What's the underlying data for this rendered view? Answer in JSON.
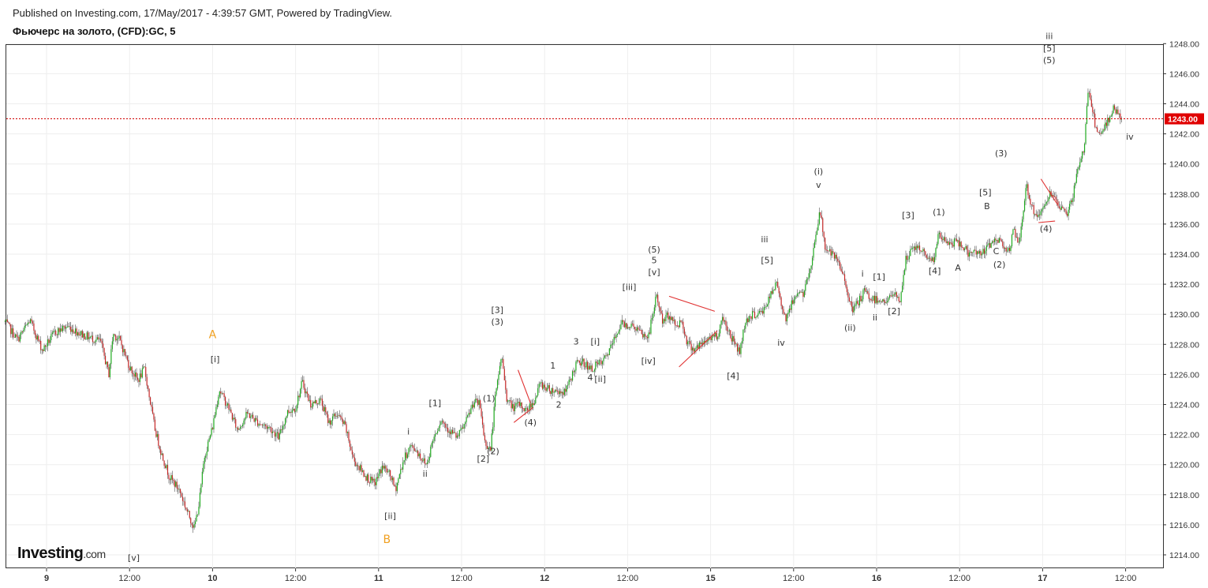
{
  "header": {
    "published": "Published on Investing.com, 17/May/2017 - 4:39:57 GMT, Powered by TradingView.",
    "instrument": "Фьючерс на золото, (CFD):GC, 5"
  },
  "logo": {
    "word": "Investing",
    "suffix": ".com"
  },
  "colors": {
    "up": "#1faa1f",
    "down": "#c62828",
    "wick": "#555555",
    "price_line": "#d00000",
    "pattern": "#e03030",
    "wave_orange": "#f0a020"
  },
  "chart_data": {
    "type": "candlestick",
    "title": "",
    "ylim": [
      1213.5,
      1249
    ],
    "y_ticks": [
      "1214.00",
      "1216.00",
      "1218.00",
      "1220.00",
      "1222.00",
      "1224.00",
      "1226.00",
      "1228.00",
      "1230.00",
      "1232.00",
      "1234.00",
      "1236.00",
      "1238.00",
      "1240.00",
      "1242.00",
      "1244.00",
      "1246.00",
      "1248.00"
    ],
    "x_ticks": [
      {
        "label": "9",
        "x": 0,
        "bold": true
      },
      {
        "label": "12:00",
        "x": 1,
        "bold": false
      },
      {
        "label": "10",
        "x": 2,
        "bold": true
      },
      {
        "label": "12:00",
        "x": 3,
        "bold": false
      },
      {
        "label": "11",
        "x": 4,
        "bold": true
      },
      {
        "label": "12:00",
        "x": 5,
        "bold": false
      },
      {
        "label": "12",
        "x": 6,
        "bold": true
      },
      {
        "label": "12:00",
        "x": 7,
        "bold": false
      },
      {
        "label": "15",
        "x": 8,
        "bold": true
      },
      {
        "label": "12:00",
        "x": 9,
        "bold": false
      },
      {
        "label": "16",
        "x": 10,
        "bold": true
      },
      {
        "label": "12:00",
        "x": 11,
        "bold": false
      },
      {
        "label": "17",
        "x": 12,
        "bold": true
      },
      {
        "label": "12:00",
        "x": 13,
        "bold": false
      }
    ],
    "xlim": [
      -0.5,
      14.0
    ],
    "last_price": "1243.00",
    "last_price_value": 1243.0,
    "price_path": [
      [
        -0.5,
        1229.5
      ],
      [
        -0.35,
        1228.3
      ],
      [
        -0.2,
        1229.6
      ],
      [
        -0.05,
        1227.6
      ],
      [
        0.1,
        1228.8
      ],
      [
        0.25,
        1229.2
      ],
      [
        0.45,
        1228.6
      ],
      [
        0.65,
        1228.2
      ],
      [
        0.75,
        1226.0
      ],
      [
        0.8,
        1228.7
      ],
      [
        0.88,
        1228.3
      ],
      [
        1.0,
        1226.5
      ],
      [
        1.1,
        1225.6
      ],
      [
        1.18,
        1226.4
      ],
      [
        1.3,
        1222.5
      ],
      [
        1.38,
        1220.8
      ],
      [
        1.48,
        1219.2
      ],
      [
        1.6,
        1218.3
      ],
      [
        1.7,
        1216.8
      ],
      [
        1.78,
        1215.8
      ],
      [
        1.84,
        1217.5
      ],
      [
        1.9,
        1220.5
      ],
      [
        2.0,
        1222.5
      ],
      [
        2.08,
        1225.0
      ],
      [
        2.2,
        1223.7
      ],
      [
        2.3,
        1222.3
      ],
      [
        2.42,
        1223.4
      ],
      [
        2.55,
        1222.8
      ],
      [
        2.7,
        1222.4
      ],
      [
        2.8,
        1221.8
      ],
      [
        2.9,
        1223.5
      ],
      [
        3.0,
        1223.8
      ],
      [
        3.08,
        1225.5
      ],
      [
        3.18,
        1224.0
      ],
      [
        3.3,
        1224.3
      ],
      [
        3.4,
        1222.8
      ],
      [
        3.5,
        1223.4
      ],
      [
        3.6,
        1222.5
      ],
      [
        3.7,
        1220.3
      ],
      [
        3.85,
        1219.2
      ],
      [
        3.95,
        1218.7
      ],
      [
        4.05,
        1219.9
      ],
      [
        4.15,
        1219.2
      ],
      [
        4.2,
        1218.3
      ],
      [
        4.3,
        1220.3
      ],
      [
        4.38,
        1221.2
      ],
      [
        4.45,
        1221.0
      ],
      [
        4.52,
        1220.4
      ],
      [
        4.58,
        1220.0
      ],
      [
        4.65,
        1221.6
      ],
      [
        4.75,
        1223.0
      ],
      [
        4.85,
        1222.3
      ],
      [
        4.95,
        1221.8
      ],
      [
        5.05,
        1222.8
      ],
      [
        5.15,
        1224.2
      ],
      [
        5.22,
        1224.0
      ],
      [
        5.28,
        1221.5
      ],
      [
        5.35,
        1221.0
      ],
      [
        5.4,
        1224.2
      ],
      [
        5.48,
        1227.3
      ],
      [
        5.55,
        1224.2
      ],
      [
        5.63,
        1223.8
      ],
      [
        5.7,
        1224.0
      ],
      [
        5.78,
        1223.6
      ],
      [
        5.88,
        1224.3
      ],
      [
        5.95,
        1225.4
      ],
      [
        6.05,
        1225.0
      ],
      [
        6.15,
        1224.9
      ],
      [
        6.25,
        1224.8
      ],
      [
        6.3,
        1225.5
      ],
      [
        6.38,
        1226.7
      ],
      [
        6.48,
        1226.8
      ],
      [
        6.55,
        1226.3
      ],
      [
        6.62,
        1226.6
      ],
      [
        6.7,
        1226.8
      ],
      [
        6.8,
        1227.8
      ],
      [
        6.92,
        1229.4
      ],
      [
        7.0,
        1229.3
      ],
      [
        7.08,
        1229.2
      ],
      [
        7.18,
        1228.6
      ],
      [
        7.25,
        1228.5
      ],
      [
        7.35,
        1231.3
      ],
      [
        7.42,
        1229.5
      ],
      [
        7.5,
        1230.0
      ],
      [
        7.58,
        1229.2
      ],
      [
        7.65,
        1229.6
      ],
      [
        7.72,
        1228.1
      ],
      [
        7.8,
        1227.7
      ],
      [
        7.9,
        1228.0
      ],
      [
        8.0,
        1228.5
      ],
      [
        8.08,
        1228.6
      ],
      [
        8.15,
        1229.8
      ],
      [
        8.22,
        1228.8
      ],
      [
        8.28,
        1228.2
      ],
      [
        8.35,
        1227.5
      ],
      [
        8.42,
        1229.6
      ],
      [
        8.52,
        1230.0
      ],
      [
        8.62,
        1230.1
      ],
      [
        8.72,
        1231.2
      ],
      [
        8.8,
        1232.1
      ],
      [
        8.85,
        1230.8
      ],
      [
        8.9,
        1229.7
      ],
      [
        8.98,
        1230.7
      ],
      [
        9.05,
        1231.6
      ],
      [
        9.12,
        1231.3
      ],
      [
        9.2,
        1233.0
      ],
      [
        9.28,
        1235.8
      ],
      [
        9.32,
        1236.8
      ],
      [
        9.38,
        1234.5
      ],
      [
        9.45,
        1234.0
      ],
      [
        9.52,
        1233.6
      ],
      [
        9.62,
        1232.3
      ],
      [
        9.7,
        1230.2
      ],
      [
        9.78,
        1230.8
      ],
      [
        9.85,
        1231.5
      ],
      [
        9.95,
        1231.0
      ],
      [
        10.05,
        1231.0
      ],
      [
        10.12,
        1230.8
      ],
      [
        10.2,
        1231.4
      ],
      [
        10.28,
        1230.9
      ],
      [
        10.35,
        1233.6
      ],
      [
        10.45,
        1234.5
      ],
      [
        10.52,
        1234.3
      ],
      [
        10.6,
        1234.0
      ],
      [
        10.68,
        1233.5
      ],
      [
        10.75,
        1235.3
      ],
      [
        10.85,
        1234.7
      ],
      [
        10.95,
        1234.8
      ],
      [
        11.05,
        1234.5
      ],
      [
        11.12,
        1233.9
      ],
      [
        11.2,
        1234.2
      ],
      [
        11.3,
        1234.1
      ],
      [
        11.38,
        1234.8
      ],
      [
        11.45,
        1235.0
      ],
      [
        11.52,
        1234.7
      ],
      [
        11.6,
        1234.2
      ],
      [
        11.65,
        1235.6
      ],
      [
        11.72,
        1234.5
      ],
      [
        11.8,
        1238.6
      ],
      [
        11.9,
        1236.6
      ],
      [
        12.0,
        1236.8
      ],
      [
        12.08,
        1238.1
      ],
      [
        12.15,
        1237.5
      ],
      [
        12.22,
        1237.0
      ],
      [
        12.3,
        1236.8
      ],
      [
        12.35,
        1237.5
      ],
      [
        12.42,
        1239.5
      ],
      [
        12.5,
        1241.0
      ],
      [
        12.55,
        1245.2
      ],
      [
        12.6,
        1243.6
      ],
      [
        12.65,
        1242.0
      ],
      [
        12.72,
        1242.0
      ],
      [
        12.78,
        1242.8
      ],
      [
        12.85,
        1243.8
      ],
      [
        12.9,
        1243.4
      ],
      [
        12.95,
        1243.0
      ]
    ],
    "annotations": [
      {
        "text": "A",
        "x": 2.0,
        "y": 1228.4,
        "color": "orange"
      },
      {
        "text": "[i]",
        "x": 2.03,
        "y": 1226.8
      },
      {
        "text": "B",
        "x": 4.1,
        "y": 1214.8,
        "color": "orange"
      },
      {
        "text": "[ii]",
        "x": 4.14,
        "y": 1216.4
      },
      {
        "text": "[v]",
        "x": 1.05,
        "y": 1213.6
      },
      {
        "text": "i",
        "x": 4.36,
        "y": 1222.0
      },
      {
        "text": "ii",
        "x": 4.56,
        "y": 1219.2
      },
      {
        "text": "[1]",
        "x": 4.68,
        "y": 1223.9
      },
      {
        "text": "[3]",
        "x": 5.43,
        "y": 1230.1
      },
      {
        "text": "(3)",
        "x": 5.43,
        "y": 1229.3
      },
      {
        "text": "(1)",
        "x": 5.33,
        "y": 1224.2
      },
      {
        "text": "[2]",
        "x": 5.26,
        "y": 1220.2
      },
      {
        "text": "(2)",
        "x": 5.38,
        "y": 1220.7
      },
      {
        "text": "(4)",
        "x": 5.83,
        "y": 1222.6
      },
      {
        "text": "1",
        "x": 6.1,
        "y": 1226.4
      },
      {
        "text": "2",
        "x": 6.17,
        "y": 1223.8
      },
      {
        "text": "3",
        "x": 6.38,
        "y": 1228.0
      },
      {
        "text": "4",
        "x": 6.55,
        "y": 1225.6
      },
      {
        "text": "[i]",
        "x": 6.61,
        "y": 1228.0
      },
      {
        "text": "[ii]",
        "x": 6.67,
        "y": 1225.5
      },
      {
        "text": "[iii]",
        "x": 7.02,
        "y": 1231.6
      },
      {
        "text": "[iv]",
        "x": 7.25,
        "y": 1226.7
      },
      {
        "text": "(5)",
        "x": 7.32,
        "y": 1234.1
      },
      {
        "text": "5",
        "x": 7.32,
        "y": 1233.4
      },
      {
        "text": "[v]",
        "x": 7.32,
        "y": 1232.6
      },
      {
        "text": "[4]",
        "x": 8.27,
        "y": 1225.7
      },
      {
        "text": "iii",
        "x": 8.65,
        "y": 1234.8
      },
      {
        "text": "[5]",
        "x": 8.68,
        "y": 1233.4
      },
      {
        "text": "iv",
        "x": 8.85,
        "y": 1227.9
      },
      {
        "text": "(i)",
        "x": 9.3,
        "y": 1239.3
      },
      {
        "text": "v",
        "x": 9.3,
        "y": 1238.4
      },
      {
        "text": "(ii)",
        "x": 9.68,
        "y": 1228.9
      },
      {
        "text": "i",
        "x": 9.83,
        "y": 1232.5
      },
      {
        "text": "[1]",
        "x": 10.03,
        "y": 1232.3
      },
      {
        "text": "ii",
        "x": 9.98,
        "y": 1229.6
      },
      {
        "text": "[2]",
        "x": 10.21,
        "y": 1230.0
      },
      {
        "text": "[3]",
        "x": 10.38,
        "y": 1236.4
      },
      {
        "text": "(1)",
        "x": 10.75,
        "y": 1236.6
      },
      {
        "text": "[4]",
        "x": 10.7,
        "y": 1232.7
      },
      {
        "text": "A",
        "x": 10.98,
        "y": 1232.9
      },
      {
        "text": "[5]",
        "x": 11.31,
        "y": 1237.9
      },
      {
        "text": "B",
        "x": 11.33,
        "y": 1237.0
      },
      {
        "text": "C",
        "x": 11.44,
        "y": 1234.0
      },
      {
        "text": "(2)",
        "x": 11.48,
        "y": 1233.1
      },
      {
        "text": "(3)",
        "x": 11.5,
        "y": 1240.5
      },
      {
        "text": "(4)",
        "x": 12.04,
        "y": 1235.5
      },
      {
        "text": "iii",
        "x": 12.08,
        "y": 1248.3
      },
      {
        "text": "[5]",
        "x": 12.08,
        "y": 1247.5
      },
      {
        "text": "(5)",
        "x": 12.08,
        "y": 1246.7
      },
      {
        "text": "iv",
        "x": 13.05,
        "y": 1241.6
      }
    ],
    "patterns": [
      [
        [
          5.68,
          1226.3
        ],
        [
          5.83,
          1224.1
        ]
      ],
      [
        [
          5.63,
          1222.8
        ],
        [
          5.86,
          1223.8
        ]
      ],
      [
        [
          7.5,
          1231.2
        ],
        [
          8.05,
          1230.2
        ]
      ],
      [
        [
          7.62,
          1226.5
        ],
        [
          8.08,
          1228.9
        ]
      ],
      [
        [
          11.98,
          1239.0
        ],
        [
          12.18,
          1237.3
        ]
      ],
      [
        [
          11.95,
          1236.1
        ],
        [
          12.15,
          1236.2
        ]
      ]
    ]
  }
}
